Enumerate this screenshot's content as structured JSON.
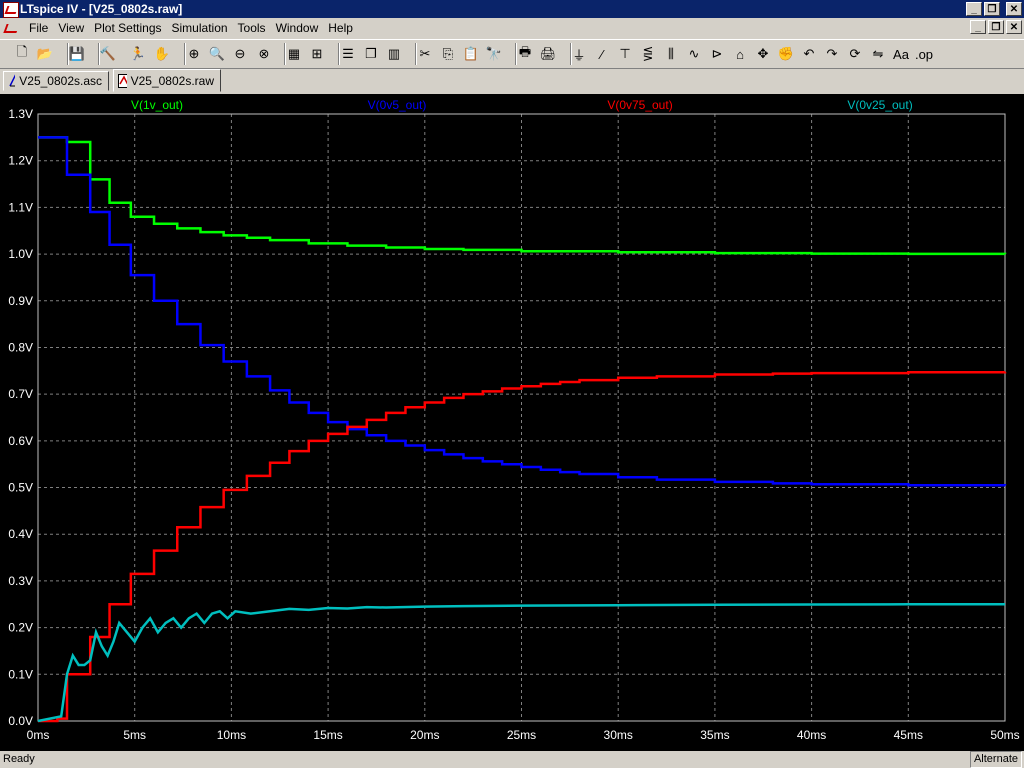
{
  "window": {
    "title": "LTspice IV - [V25_0802s.raw]"
  },
  "menu": {
    "items": [
      "File",
      "View",
      "Plot Settings",
      "Simulation",
      "Tools",
      "Window",
      "Help"
    ]
  },
  "tabs": [
    {
      "label": "V25_0802s.asc",
      "icon": "schematic-icon",
      "active": false
    },
    {
      "label": "V25_0802s.raw",
      "icon": "waveform-icon",
      "active": true
    }
  ],
  "toolbar": {
    "icons": [
      "new-schematic-icon",
      "open-icon",
      "save-icon",
      "control-panel-icon",
      "run-icon",
      "halt-icon",
      "zoom-in-icon",
      "zoom-pan-icon",
      "zoom-out-icon",
      "zoom-cancel-icon",
      "autorange-icon",
      "measure-icon",
      "tile-horizontal-icon",
      "cascade-icon",
      "tile-vertical-icon",
      "cut-icon",
      "copy-icon",
      "paste-icon",
      "find-icon",
      "print-preview-icon",
      "print-icon",
      "ground-icon",
      "wire-icon",
      "label-icon",
      "resistor-icon",
      "capacitor-icon",
      "inductor-icon",
      "diode-icon",
      "component-icon",
      "move-icon",
      "drag-icon",
      "undo-icon",
      "redo-icon",
      "rotate-icon",
      "mirror-icon",
      "text-icon",
      "spice-directive-icon"
    ]
  },
  "status": {
    "left": "Ready",
    "right": "Alternate"
  },
  "colors": {
    "green": "#00ff00",
    "blue": "#0000ff",
    "red": "#ff0000",
    "cyan": "#00bfbf",
    "grid": "#808080",
    "axis_text": "#ffffff"
  },
  "chart_data": {
    "type": "line",
    "title": "",
    "xlabel": "",
    "ylabel": "",
    "xlim": [
      0,
      50
    ],
    "ylim": [
      0,
      1.3
    ],
    "x_unit": "ms",
    "y_unit": "V",
    "grid": true,
    "x_ticks": [
      "0ms",
      "5ms",
      "10ms",
      "15ms",
      "20ms",
      "25ms",
      "30ms",
      "35ms",
      "40ms",
      "45ms",
      "50ms"
    ],
    "y_ticks": [
      "0.0V",
      "0.1V",
      "0.2V",
      "0.3V",
      "0.4V",
      "0.5V",
      "0.6V",
      "0.7V",
      "0.8V",
      "0.9V",
      "1.0V",
      "1.1V",
      "1.2V",
      "1.3V"
    ],
    "legend_placement": "top",
    "series": [
      {
        "name": "V(1v_out)",
        "color": "#00ff00",
        "step": true,
        "x": [
          0,
          1.5,
          2.7,
          3.7,
          4.8,
          6.0,
          7.2,
          8.4,
          9.6,
          10.8,
          12,
          14,
          16,
          18,
          20,
          22,
          25,
          30,
          35,
          40,
          45,
          50
        ],
        "y": [
          1.25,
          1.24,
          1.16,
          1.11,
          1.08,
          1.065,
          1.055,
          1.047,
          1.04,
          1.035,
          1.03,
          1.023,
          1.018,
          1.014,
          1.011,
          1.009,
          1.006,
          1.004,
          1.002,
          1.001,
          1.0005,
          1.0
        ]
      },
      {
        "name": "V(0v5_out)",
        "color": "#0000ff",
        "step": true,
        "x": [
          0,
          1.5,
          2.7,
          3.7,
          4.8,
          6.0,
          7.2,
          8.4,
          9.6,
          10.8,
          12,
          13,
          14,
          15,
          16,
          17,
          18,
          19,
          20,
          21,
          22,
          23,
          24,
          25,
          26,
          27,
          28,
          30,
          32,
          35,
          38,
          40,
          45,
          50
        ],
        "y": [
          1.25,
          1.17,
          1.09,
          1.02,
          0.955,
          0.9,
          0.85,
          0.805,
          0.77,
          0.738,
          0.708,
          0.682,
          0.66,
          0.64,
          0.625,
          0.612,
          0.6,
          0.59,
          0.58,
          0.571,
          0.563,
          0.556,
          0.55,
          0.544,
          0.538,
          0.533,
          0.529,
          0.522,
          0.517,
          0.512,
          0.509,
          0.507,
          0.505,
          0.504
        ]
      },
      {
        "name": "V(0v75_out)",
        "color": "#ff0000",
        "step": true,
        "x": [
          0,
          1.0,
          1.5,
          2.7,
          3.7,
          4.8,
          6.0,
          7.2,
          8.4,
          9.6,
          10.8,
          12,
          13,
          14,
          15,
          16,
          17,
          18,
          19,
          20,
          21,
          22,
          23,
          24,
          25,
          26,
          27,
          28,
          30,
          32,
          35,
          38,
          40,
          45,
          50
        ],
        "y": [
          0,
          0.005,
          0.1,
          0.18,
          0.25,
          0.315,
          0.365,
          0.415,
          0.458,
          0.495,
          0.525,
          0.553,
          0.578,
          0.6,
          0.615,
          0.63,
          0.645,
          0.66,
          0.672,
          0.682,
          0.692,
          0.7,
          0.706,
          0.712,
          0.717,
          0.722,
          0.726,
          0.73,
          0.735,
          0.738,
          0.742,
          0.744,
          0.745,
          0.747,
          0.748
        ]
      },
      {
        "name": "V(0v25_out)",
        "color": "#00bfbf",
        "step": false,
        "x": [
          0,
          1.2,
          1.5,
          1.8,
          2.1,
          2.4,
          2.7,
          3.0,
          3.3,
          3.6,
          3.9,
          4.2,
          4.6,
          5.0,
          5.4,
          5.8,
          6.2,
          6.6,
          7.0,
          7.4,
          7.8,
          8.2,
          8.6,
          9.0,
          9.4,
          9.8,
          10.2,
          11,
          12,
          13,
          14,
          15,
          16,
          17,
          18,
          20,
          22,
          25,
          30,
          35,
          40,
          45,
          50
        ],
        "y": [
          0,
          0.01,
          0.1,
          0.14,
          0.12,
          0.12,
          0.13,
          0.19,
          0.16,
          0.14,
          0.17,
          0.21,
          0.19,
          0.17,
          0.2,
          0.22,
          0.19,
          0.21,
          0.22,
          0.2,
          0.22,
          0.23,
          0.21,
          0.23,
          0.235,
          0.22,
          0.235,
          0.23,
          0.235,
          0.24,
          0.238,
          0.242,
          0.241,
          0.244,
          0.243,
          0.245,
          0.246,
          0.247,
          0.248,
          0.249,
          0.2495,
          0.25,
          0.25
        ]
      }
    ]
  }
}
